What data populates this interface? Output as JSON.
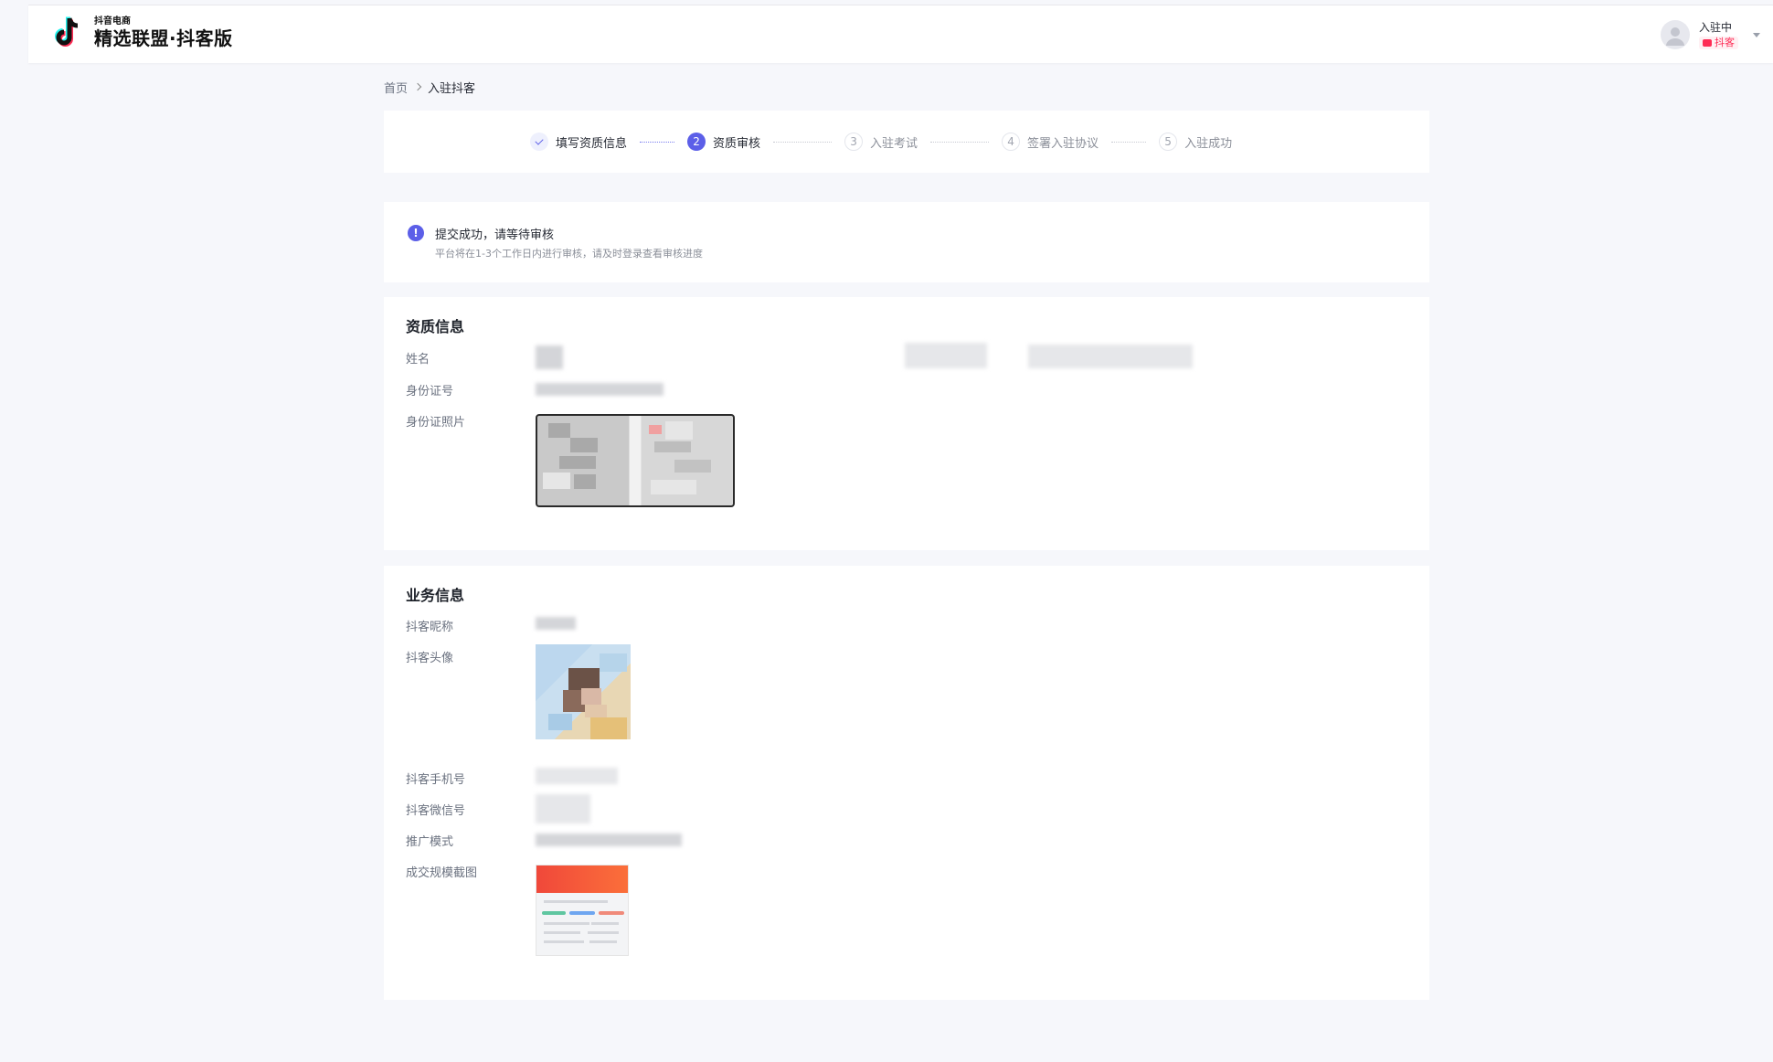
{
  "header": {
    "logo_small": "抖音电商",
    "logo_big": "精选联盟·抖客版",
    "user_status": "入驻中",
    "user_tag": "抖客"
  },
  "breadcrumb": {
    "home": "首页",
    "current": "入驻抖客"
  },
  "steps": [
    {
      "index": "1",
      "label": "填写资质信息",
      "state": "done"
    },
    {
      "index": "2",
      "label": "资质审核",
      "state": "active"
    },
    {
      "index": "3",
      "label": "入驻考试",
      "state": "todo"
    },
    {
      "index": "4",
      "label": "签署入驻协议",
      "state": "todo"
    },
    {
      "index": "5",
      "label": "入驻成功",
      "state": "todo"
    }
  ],
  "notice": {
    "icon": "!",
    "title": "提交成功，请等待审核",
    "desc": "平台将在1-3个工作日内进行审核，请及时登录查看审核进度"
  },
  "qualification": {
    "title": "资质信息",
    "labels": {
      "name": "姓名",
      "id_number": "身份证号",
      "id_photo": "身份证照片"
    }
  },
  "business": {
    "title": "业务信息",
    "labels": {
      "nickname": "抖客昵称",
      "avatar": "抖客头像",
      "phone": "抖客手机号",
      "wechat": "抖客微信号",
      "promo_mode": "推广模式",
      "deal_screenshot": "成交规模截图"
    }
  },
  "colors": {
    "primary": "#5c5fe8",
    "brand_red": "#fe2c55",
    "page_bg": "#f6f7fb"
  }
}
